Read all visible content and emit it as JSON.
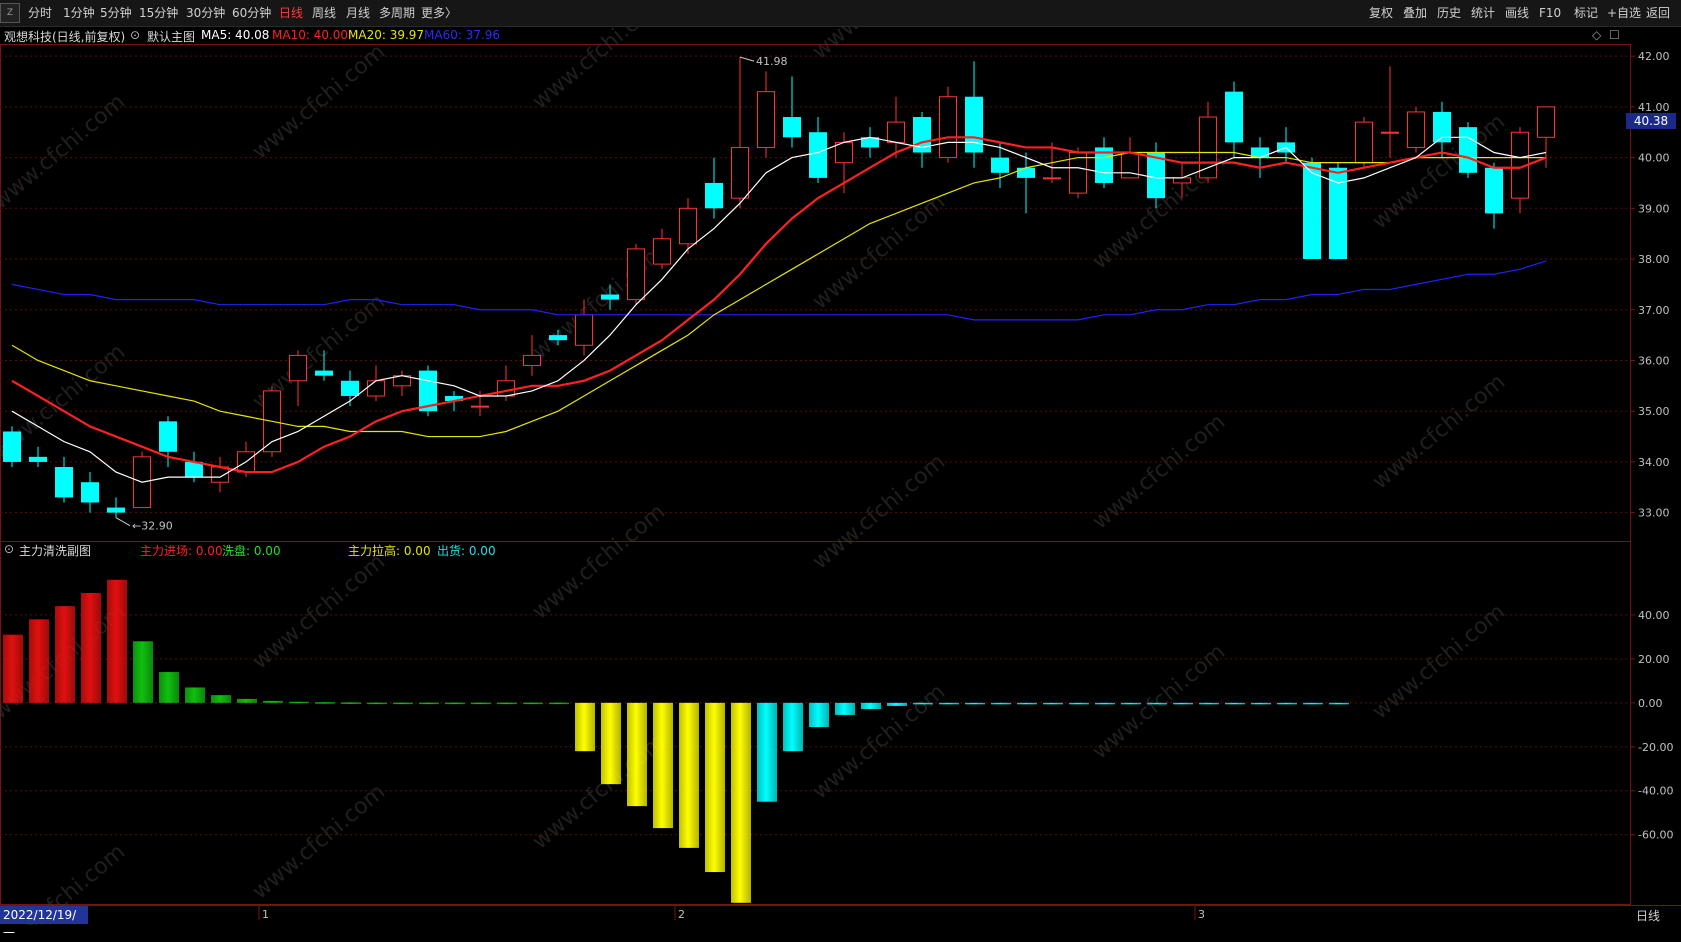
{
  "toolbar": {
    "logo": "Z",
    "periods": [
      "分时",
      "1分钟",
      "5分钟",
      "15分钟",
      "30分钟",
      "60分钟",
      "日线",
      "周线",
      "月线",
      "多周期",
      "更多〉"
    ],
    "active_period": "日线",
    "right_buttons": [
      "复权",
      "叠加",
      "历史",
      "统计",
      "画线",
      "F10",
      "标记",
      "+自选",
      "返回"
    ]
  },
  "info": {
    "stock": "观想科技(日线,前复权)",
    "template": "默认主图",
    "ma5": "MA5: 40.08",
    "ma10": "MA10: 40.00",
    "ma20": "MA20: 39.97",
    "ma60": "MA60: 37.96"
  },
  "indicator": {
    "name": "主力清洗副图",
    "zljc": "主力进场: 0.00",
    "xp": "洗盘: 0.00",
    "zllg": "主力拉高: 0.00",
    "ch": "出货: 0.00"
  },
  "price_tag": "40.38",
  "date_label": "2022/12/19/一",
  "period_label": "日线",
  "watermark": "www.cfchi.com",
  "colors": {
    "up": "#ff3232",
    "down": "#00ffff",
    "ma5": "#ffffff",
    "ma10": "#ff2020",
    "ma20": "#e5e500",
    "ma60": "#2020ff",
    "bar_red": "#e01010",
    "bar_green": "#10c010",
    "bar_yellow": "#ffff00",
    "bar_cyan": "#00ffff"
  },
  "chart_data": [
    {
      "type": "candlestick",
      "title": "观想科技(日线,前复权)",
      "ylim": [
        32.5,
        42.2
      ],
      "y_ticks": [
        33.0,
        34.0,
        35.0,
        36.0,
        37.0,
        38.0,
        39.0,
        40.0,
        41.0,
        42.0
      ],
      "month_markers": [
        {
          "index": 10,
          "label": "1"
        },
        {
          "index": 26,
          "label": "2"
        },
        {
          "index": 46,
          "label": "3"
        }
      ],
      "annotations": [
        {
          "index": 28,
          "price": 41.98,
          "label": "41.98"
        },
        {
          "index": 4,
          "price": 32.9,
          "label": "32.90"
        }
      ],
      "candles": [
        [
          34.6,
          34.0,
          34.7,
          33.9
        ],
        [
          34.1,
          34.0,
          34.3,
          33.9
        ],
        [
          33.9,
          33.3,
          34.1,
          33.2
        ],
        [
          33.6,
          33.2,
          33.8,
          33.0
        ],
        [
          33.1,
          33.0,
          33.3,
          32.9
        ],
        [
          33.1,
          34.1,
          34.2,
          33.1
        ],
        [
          34.8,
          34.2,
          34.9,
          33.9
        ],
        [
          34.0,
          33.7,
          34.2,
          33.6
        ],
        [
          33.6,
          33.9,
          34.1,
          33.4
        ],
        [
          33.8,
          34.2,
          34.4,
          33.7
        ],
        [
          34.2,
          35.4,
          35.5,
          34.1
        ],
        [
          35.6,
          36.1,
          36.2,
          35.1
        ],
        [
          35.8,
          35.7,
          36.2,
          35.6
        ],
        [
          35.6,
          35.3,
          35.8,
          35.1
        ],
        [
          35.3,
          35.6,
          35.9,
          35.2
        ],
        [
          35.5,
          35.7,
          35.8,
          35.3
        ],
        [
          35.8,
          35.0,
          35.9,
          34.9
        ],
        [
          35.3,
          35.2,
          35.4,
          35.0
        ],
        [
          35.1,
          35.1,
          35.4,
          34.9
        ],
        [
          35.3,
          35.6,
          35.9,
          35.2
        ],
        [
          35.9,
          36.1,
          36.5,
          35.7
        ],
        [
          36.5,
          36.4,
          36.6,
          36.3
        ],
        [
          36.3,
          36.9,
          37.2,
          36.1
        ],
        [
          37.3,
          37.2,
          37.5,
          37.0
        ],
        [
          37.2,
          38.2,
          38.3,
          37.1
        ],
        [
          37.9,
          38.4,
          38.6,
          37.8
        ],
        [
          38.3,
          39.0,
          39.2,
          38.1
        ],
        [
          39.5,
          39.0,
          40.0,
          38.8
        ],
        [
          39.2,
          40.2,
          41.98,
          39.0
        ],
        [
          40.2,
          41.3,
          41.7,
          40.0
        ],
        [
          40.8,
          40.4,
          41.6,
          40.2
        ],
        [
          40.5,
          39.6,
          40.8,
          39.5
        ],
        [
          39.9,
          40.3,
          40.5,
          39.3
        ],
        [
          40.4,
          40.2,
          40.6,
          40.0
        ],
        [
          40.3,
          40.7,
          41.2,
          40.0
        ],
        [
          40.8,
          40.1,
          40.9,
          39.8
        ],
        [
          40.0,
          41.2,
          41.4,
          39.9
        ],
        [
          41.2,
          40.1,
          41.9,
          39.8
        ],
        [
          40.0,
          39.7,
          40.3,
          39.4
        ],
        [
          39.8,
          39.6,
          40.1,
          38.9
        ],
        [
          39.6,
          39.6,
          40.3,
          39.5
        ],
        [
          39.3,
          40.1,
          40.2,
          39.2
        ],
        [
          40.2,
          39.5,
          40.4,
          39.4
        ],
        [
          39.6,
          40.1,
          40.4,
          39.6
        ],
        [
          40.1,
          39.2,
          40.3,
          39.0
        ],
        [
          39.5,
          39.6,
          39.9,
          39.2
        ],
        [
          39.6,
          40.8,
          41.1,
          39.5
        ],
        [
          41.3,
          40.3,
          41.5,
          40.0
        ],
        [
          40.2,
          40.0,
          40.4,
          39.6
        ],
        [
          40.3,
          40.1,
          40.6,
          39.9
        ],
        [
          39.9,
          38.0,
          40.0,
          38.0
        ],
        [
          39.8,
          38.0,
          39.9,
          38.0
        ],
        [
          39.9,
          40.7,
          40.8,
          39.8
        ],
        [
          40.5,
          40.5,
          41.8,
          40.0
        ],
        [
          40.2,
          40.9,
          41.0,
          40.1
        ],
        [
          40.9,
          40.3,
          41.1,
          40.0
        ],
        [
          40.6,
          39.7,
          40.7,
          39.6
        ],
        [
          39.8,
          38.9,
          39.9,
          38.6
        ],
        [
          39.2,
          40.5,
          40.6,
          38.9
        ],
        [
          40.4,
          41.0,
          41.0,
          39.8
        ]
      ],
      "ma5": [
        35.0,
        34.7,
        34.4,
        34.2,
        33.8,
        33.6,
        33.7,
        33.7,
        33.7,
        34.0,
        34.4,
        34.6,
        34.9,
        35.2,
        35.6,
        35.7,
        35.6,
        35.5,
        35.3,
        35.3,
        35.4,
        35.6,
        36.0,
        36.5,
        37.1,
        37.6,
        38.2,
        38.6,
        39.1,
        39.7,
        40.0,
        40.1,
        40.3,
        40.4,
        40.3,
        40.2,
        40.3,
        40.3,
        40.2,
        40.0,
        39.8,
        39.8,
        39.7,
        39.7,
        39.6,
        39.6,
        39.8,
        40.0,
        40.0,
        40.2,
        39.7,
        39.5,
        39.6,
        39.8,
        40.0,
        40.4,
        40.4,
        40.1,
        40.0,
        40.1
      ],
      "ma10": [
        35.6,
        35.3,
        35.0,
        34.7,
        34.5,
        34.3,
        34.1,
        34.0,
        33.9,
        33.8,
        33.8,
        34.0,
        34.3,
        34.5,
        34.8,
        35.0,
        35.1,
        35.2,
        35.3,
        35.4,
        35.5,
        35.5,
        35.6,
        35.8,
        36.1,
        36.4,
        36.8,
        37.2,
        37.7,
        38.3,
        38.8,
        39.2,
        39.5,
        39.8,
        40.1,
        40.3,
        40.4,
        40.4,
        40.3,
        40.2,
        40.2,
        40.1,
        40.1,
        40.1,
        40.0,
        39.9,
        39.9,
        39.9,
        39.8,
        39.9,
        39.8,
        39.7,
        39.8,
        39.9,
        40.0,
        40.1,
        40.0,
        39.8,
        39.8,
        40.0
      ],
      "ma20": [
        36.3,
        36.0,
        35.8,
        35.6,
        35.5,
        35.4,
        35.3,
        35.2,
        35.0,
        34.9,
        34.8,
        34.7,
        34.7,
        34.6,
        34.6,
        34.6,
        34.5,
        34.5,
        34.5,
        34.6,
        34.8,
        35.0,
        35.3,
        35.6,
        35.9,
        36.2,
        36.5,
        36.9,
        37.2,
        37.5,
        37.8,
        38.1,
        38.4,
        38.7,
        38.9,
        39.1,
        39.3,
        39.5,
        39.6,
        39.8,
        39.9,
        40.0,
        40.0,
        40.1,
        40.1,
        40.1,
        40.1,
        40.1,
        40.0,
        40.0,
        39.9,
        39.9,
        39.9,
        39.9,
        40.0,
        40.0,
        40.0,
        40.0,
        40.0,
        40.0
      ],
      "ma60": [
        37.5,
        37.4,
        37.3,
        37.3,
        37.2,
        37.2,
        37.2,
        37.2,
        37.1,
        37.1,
        37.1,
        37.1,
        37.1,
        37.2,
        37.2,
        37.1,
        37.1,
        37.1,
        37.0,
        37.0,
        37.0,
        36.9,
        36.9,
        36.9,
        36.9,
        36.9,
        36.9,
        36.9,
        36.9,
        36.9,
        36.9,
        36.9,
        36.9,
        36.9,
        36.9,
        36.9,
        36.9,
        36.8,
        36.8,
        36.8,
        36.8,
        36.8,
        36.9,
        36.9,
        37.0,
        37.0,
        37.1,
        37.1,
        37.2,
        37.2,
        37.3,
        37.3,
        37.4,
        37.4,
        37.5,
        37.6,
        37.7,
        37.7,
        37.8,
        37.96
      ]
    },
    {
      "type": "bar",
      "title": "主力清洗副图",
      "ylim": [
        -92,
        65
      ],
      "y_ticks": [
        40.0,
        20.0,
        0.0,
        -20.0,
        -40.0,
        -60.0
      ],
      "bars": [
        {
          "v": 31,
          "c": "red"
        },
        {
          "v": 38,
          "c": "red"
        },
        {
          "v": 44,
          "c": "red"
        },
        {
          "v": 50,
          "c": "red"
        },
        {
          "v": 56,
          "c": "red"
        },
        {
          "v": 28,
          "c": "green"
        },
        {
          "v": 14,
          "c": "green"
        },
        {
          "v": 7,
          "c": "green"
        },
        {
          "v": 3.5,
          "c": "green"
        },
        {
          "v": 1.8,
          "c": "green"
        },
        {
          "v": 0.9,
          "c": "green"
        },
        {
          "v": 0.5,
          "c": "green"
        },
        {
          "v": 0.3,
          "c": "green"
        },
        {
          "v": 0.2,
          "c": "green"
        },
        {
          "v": 0.1,
          "c": "green"
        },
        {
          "v": 0.1,
          "c": "green"
        },
        {
          "v": 0.1,
          "c": "green"
        },
        {
          "v": 0.1,
          "c": "green"
        },
        {
          "v": 0.1,
          "c": "green"
        },
        {
          "v": 0.1,
          "c": "green"
        },
        {
          "v": 0.1,
          "c": "green"
        },
        {
          "v": 0.1,
          "c": "green"
        },
        {
          "v": -22,
          "c": "yellow"
        },
        {
          "v": -37,
          "c": "yellow"
        },
        {
          "v": -47,
          "c": "yellow"
        },
        {
          "v": -57,
          "c": "yellow"
        },
        {
          "v": -66,
          "c": "yellow"
        },
        {
          "v": -77,
          "c": "yellow"
        },
        {
          "v": -91,
          "c": "yellow"
        },
        {
          "v": -45,
          "c": "cyan"
        },
        {
          "v": -22,
          "c": "cyan"
        },
        {
          "v": -11,
          "c": "cyan"
        },
        {
          "v": -5.5,
          "c": "cyan"
        },
        {
          "v": -2.8,
          "c": "cyan"
        },
        {
          "v": -1.4,
          "c": "cyan"
        },
        {
          "v": -0.7,
          "c": "cyan"
        },
        {
          "v": -0.4,
          "c": "cyan"
        },
        {
          "v": -0.2,
          "c": "cyan"
        },
        {
          "v": -0.1,
          "c": "cyan"
        },
        {
          "v": -0.1,
          "c": "cyan"
        },
        {
          "v": -0.1,
          "c": "cyan"
        },
        {
          "v": -0.1,
          "c": "cyan"
        },
        {
          "v": -0.1,
          "c": "cyan"
        },
        {
          "v": -0.1,
          "c": "cyan"
        },
        {
          "v": -0.1,
          "c": "cyan"
        },
        {
          "v": -0.1,
          "c": "cyan"
        },
        {
          "v": -0.1,
          "c": "cyan"
        },
        {
          "v": -0.1,
          "c": "cyan"
        },
        {
          "v": -0.1,
          "c": "cyan"
        },
        {
          "v": -0.1,
          "c": "cyan"
        },
        {
          "v": -0.1,
          "c": "cyan"
        },
        {
          "v": -0.1,
          "c": "cyan"
        }
      ]
    }
  ]
}
